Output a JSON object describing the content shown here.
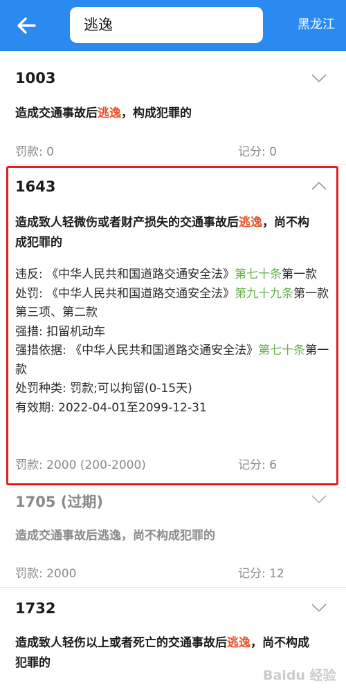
{
  "header": {
    "back_icon": "arrow-left-icon",
    "search_value": "逃逸",
    "region": "黑龙江"
  },
  "colors": {
    "header_bg": "#2b8af0",
    "highlight": "#e8542a",
    "law_link": "#6ab04c",
    "selection_box": "#e02020"
  },
  "items": [
    {
      "code": "1003",
      "desc_pre": "造成交通事故后",
      "desc_hl": "逃逸",
      "desc_post": "，构成犯罪的",
      "fine": "罚款: 0",
      "points": "记分: 0",
      "expanded": false
    },
    {
      "code": "1643",
      "desc_pre": "造成致人轻微伤或者财产损失的交通事故后",
      "desc_hl": "逃逸",
      "desc_post": "，尚不构成犯罪的",
      "violation_prefix": "违反: 《中华人民共和国道路交通安全法》",
      "violation_link": "第七十条",
      "violation_suffix": "第一款",
      "penalty_prefix": "处罚: 《中华人民共和国道路交通安全法》",
      "penalty_link": "第九十九条",
      "penalty_suffix": "第一款第三项、第二款",
      "measure": "强措: 扣留机动车",
      "measure_basis_prefix": "强措依据: 《中华人民共和国道路交通安全法》",
      "measure_basis_link": "第七十条",
      "measure_basis_suffix": "第一款",
      "penalty_type": "处罚种类: 罚款;可以拘留(0-15天)",
      "validity": "有效期: 2022-04-01至2099-12-31",
      "fine": "罚款: 2000 (200-2000)",
      "points": "记分: 6",
      "expanded": true
    },
    {
      "code": "1705 (过期)",
      "desc": "造成交通事故后逃逸，尚不构成犯罪的",
      "fine": "罚款: 2000",
      "points": "记分: 12",
      "expanded": false,
      "expired": true
    },
    {
      "code": "1732",
      "desc_pre": "造成致人轻伤以上或者死亡的交通事故后",
      "desc_hl": "逃逸",
      "desc_post": "，尚不构成犯罪的",
      "expanded": false
    }
  ],
  "watermark": "Baidu 经验"
}
